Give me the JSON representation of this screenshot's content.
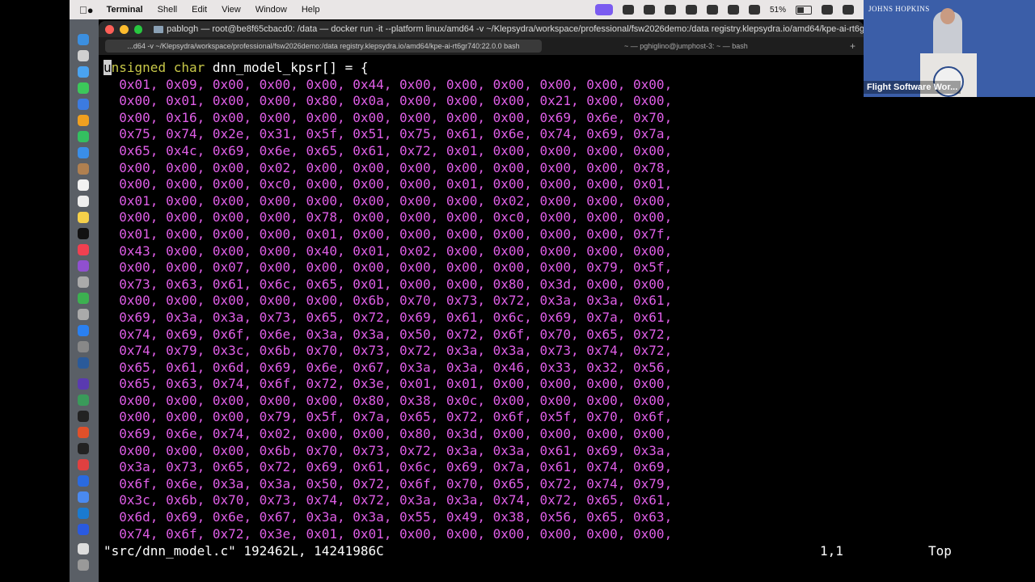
{
  "menubar": {
    "app": "Terminal",
    "items": [
      "Shell",
      "Edit",
      "View",
      "Window",
      "Help"
    ],
    "battery": "51%"
  },
  "window": {
    "title": "pablogh — root@be8f65cbacd0: /data — docker run -it --platform linux/amd64 -v ~/Klepsydra/workspace/professional/fsw2026demo:/data registry.klepsydra.io/amd64/kpe-ai-rt6gr74",
    "tab_active": "...d64 -v ~/Klepsydra/workspace/professional/fsw2026demo:/data registry.klepsydra.io/amd64/kpe-ai-rt6gr740:22.0.0 bash",
    "tab_inactive": "~ — pghiglino@jumphost-3: ~ — bash",
    "tab_add": "+"
  },
  "editor": {
    "decl_keyword1": "unsigned",
    "decl_keyword2": "char",
    "decl_name": "dnn_model_kpsr[] = {",
    "rows": [
      "0x01, 0x09, 0x00, 0x00, 0x00, 0x44, 0x00, 0x00, 0x00, 0x00, 0x00, 0x00,",
      "0x00, 0x01, 0x00, 0x00, 0x80, 0x0a, 0x00, 0x00, 0x00, 0x21, 0x00, 0x00,",
      "0x00, 0x16, 0x00, 0x00, 0x00, 0x00, 0x00, 0x00, 0x00, 0x69, 0x6e, 0x70,",
      "0x75, 0x74, 0x2e, 0x31, 0x5f, 0x51, 0x75, 0x61, 0x6e, 0x74, 0x69, 0x7a,",
      "0x65, 0x4c, 0x69, 0x6e, 0x65, 0x61, 0x72, 0x01, 0x00, 0x00, 0x00, 0x00,",
      "0x00, 0x00, 0x00, 0x02, 0x00, 0x00, 0x00, 0x00, 0x00, 0x00, 0x00, 0x78,",
      "0x00, 0x00, 0x00, 0xc0, 0x00, 0x00, 0x00, 0x01, 0x00, 0x00, 0x00, 0x01,",
      "0x01, 0x00, 0x00, 0x00, 0x00, 0x00, 0x00, 0x00, 0x02, 0x00, 0x00, 0x00,",
      "0x00, 0x00, 0x00, 0x00, 0x78, 0x00, 0x00, 0x00, 0xc0, 0x00, 0x00, 0x00,",
      "0x01, 0x00, 0x00, 0x00, 0x01, 0x00, 0x00, 0x00, 0x00, 0x00, 0x00, 0x7f,",
      "0x43, 0x00, 0x00, 0x00, 0x40, 0x01, 0x02, 0x00, 0x00, 0x00, 0x00, 0x00,",
      "0x00, 0x00, 0x07, 0x00, 0x00, 0x00, 0x00, 0x00, 0x00, 0x00, 0x79, 0x5f,",
      "0x73, 0x63, 0x61, 0x6c, 0x65, 0x01, 0x00, 0x00, 0x80, 0x3d, 0x00, 0x00,",
      "0x00, 0x00, 0x00, 0x00, 0x00, 0x6b, 0x70, 0x73, 0x72, 0x3a, 0x3a, 0x61,",
      "0x69, 0x3a, 0x3a, 0x73, 0x65, 0x72, 0x69, 0x61, 0x6c, 0x69, 0x7a, 0x61,",
      "0x74, 0x69, 0x6f, 0x6e, 0x3a, 0x3a, 0x50, 0x72, 0x6f, 0x70, 0x65, 0x72,",
      "0x74, 0x79, 0x3c, 0x6b, 0x70, 0x73, 0x72, 0x3a, 0x3a, 0x73, 0x74, 0x72,",
      "0x65, 0x61, 0x6d, 0x69, 0x6e, 0x67, 0x3a, 0x3a, 0x46, 0x33, 0x32, 0x56,",
      "0x65, 0x63, 0x74, 0x6f, 0x72, 0x3e, 0x01, 0x01, 0x00, 0x00, 0x00, 0x00,",
      "0x00, 0x00, 0x00, 0x00, 0x00, 0x80, 0x38, 0x0c, 0x00, 0x00, 0x00, 0x00,",
      "0x00, 0x00, 0x00, 0x79, 0x5f, 0x7a, 0x65, 0x72, 0x6f, 0x5f, 0x70, 0x6f,",
      "0x69, 0x6e, 0x74, 0x02, 0x00, 0x00, 0x80, 0x3d, 0x00, 0x00, 0x00, 0x00,",
      "0x00, 0x00, 0x00, 0x6b, 0x70, 0x73, 0x72, 0x3a, 0x3a, 0x61, 0x69, 0x3a,",
      "0x3a, 0x73, 0x65, 0x72, 0x69, 0x61, 0x6c, 0x69, 0x7a, 0x61, 0x74, 0x69,",
      "0x6f, 0x6e, 0x3a, 0x3a, 0x50, 0x72, 0x6f, 0x70, 0x65, 0x72, 0x74, 0x79,",
      "0x3c, 0x6b, 0x70, 0x73, 0x74, 0x72, 0x3a, 0x3a, 0x74, 0x72, 0x65, 0x61,",
      "0x6d, 0x69, 0x6e, 0x67, 0x3a, 0x3a, 0x55, 0x49, 0x38, 0x56, 0x65, 0x63,",
      "0x74, 0x6f, 0x72, 0x3e, 0x01, 0x01, 0x00, 0x00, 0x00, 0x00, 0x00, 0x00,"
    ],
    "status_file": "\"src/dnn_model.c\" 192462L, 14241986C",
    "status_pos": "1,1",
    "status_top": "Top"
  },
  "video": {
    "logo": "JOHNS HOPKINS",
    "caption": "Flight Software Wor..."
  },
  "colors": {
    "keyword": "#c8c849",
    "hex": "#e05ee8",
    "background": "#000000"
  }
}
